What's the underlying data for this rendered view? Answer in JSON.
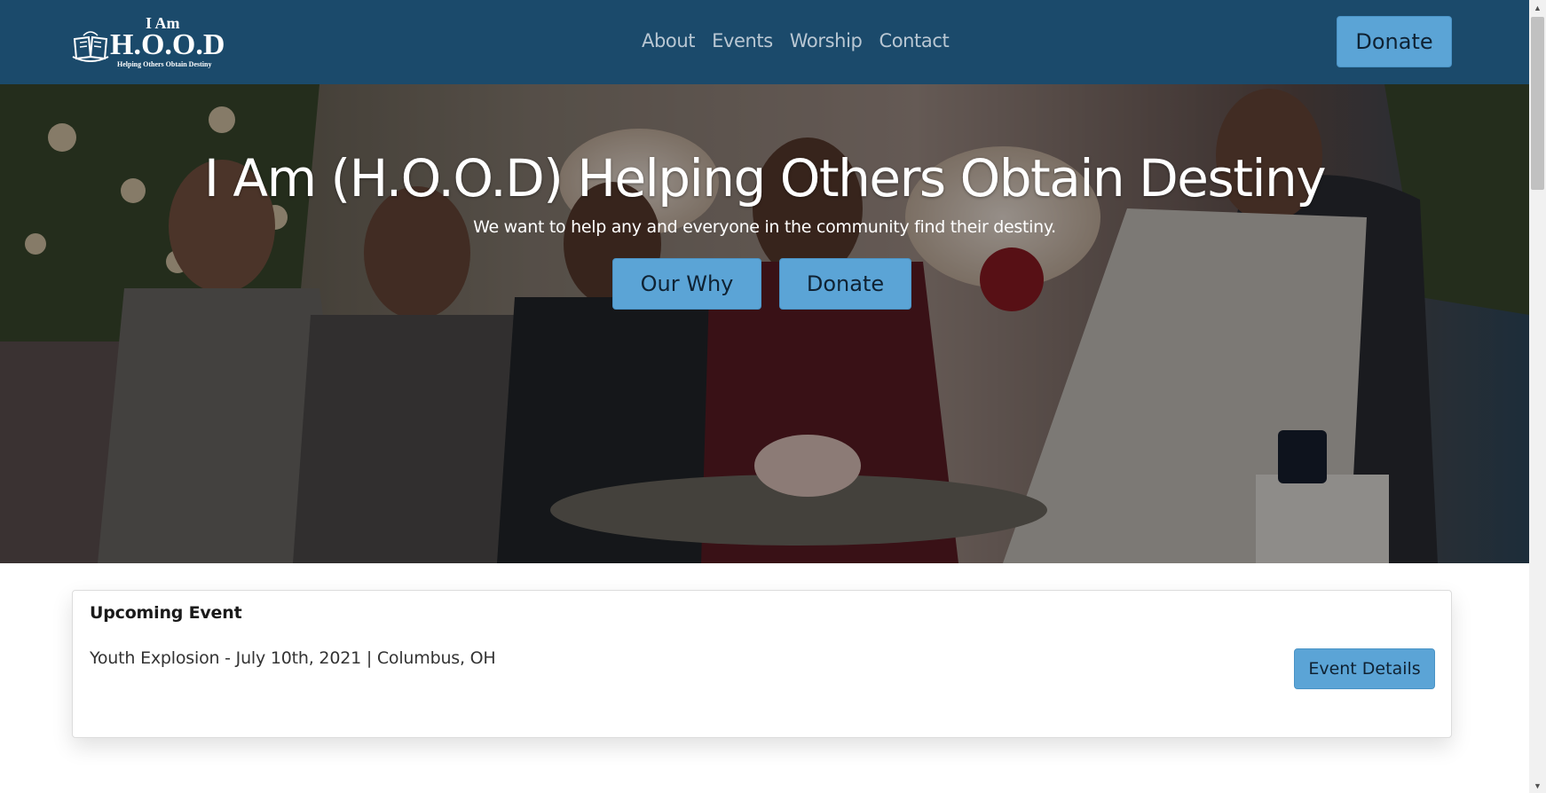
{
  "navbar": {
    "logo": {
      "top_text": "I Am",
      "main_text": "H.O.O.D",
      "tagline": "Helping Others Obtain Destiny"
    },
    "links": [
      {
        "label": "About"
      },
      {
        "label": "Events"
      },
      {
        "label": "Worship"
      },
      {
        "label": "Contact"
      }
    ],
    "donate_label": "Donate"
  },
  "hero": {
    "title": "I Am (H.O.O.D) Helping Others Obtain Destiny",
    "subtitle": "We want to help any and everyone in the community find their destiny.",
    "buttons": {
      "our_why": "Our Why",
      "donate": "Donate"
    }
  },
  "event": {
    "heading": "Upcoming Event",
    "description": "Youth Explosion - July 10th, 2021 | Columbus, OH",
    "button_label": "Event Details"
  },
  "colors": {
    "navbar_bg": "#1b4a6b",
    "button_bg": "#5ba4d6",
    "nav_link": "#b9c7d3"
  },
  "icons": {
    "logo_book": "open-book-icon",
    "scroll_up": "scroll-up-arrow-icon",
    "scroll_down": "scroll-down-arrow-icon"
  }
}
